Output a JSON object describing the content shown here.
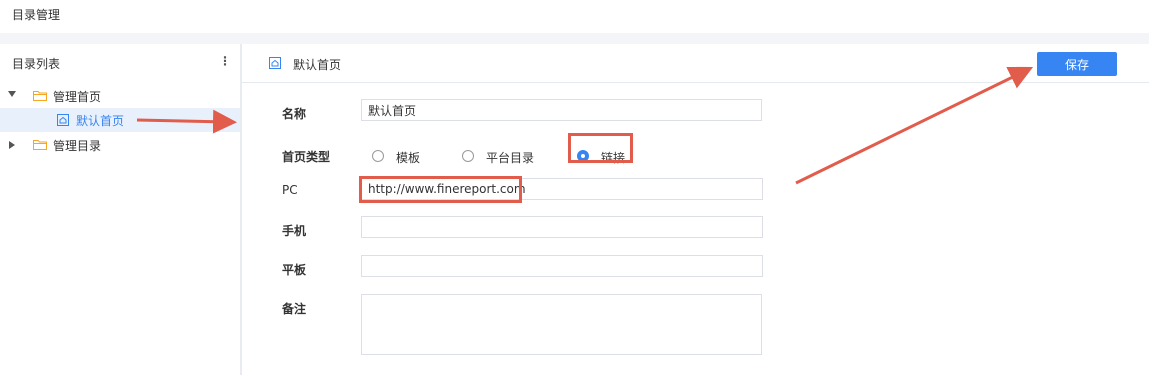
{
  "app": {
    "title": "目录管理"
  },
  "sidebar": {
    "header": "目录列表",
    "more_icon": "vertical-ellipsis-icon",
    "items": [
      {
        "label": "管理首页",
        "icon": "folder-icon",
        "expanded": true
      },
      {
        "label": "默认首页",
        "icon": "home-page-icon",
        "selected": true
      },
      {
        "label": "管理目录",
        "icon": "folder-icon",
        "expanded": false
      }
    ]
  },
  "detail": {
    "title": "默认首页",
    "save_label": "保存",
    "fields": {
      "name": {
        "label": "名称",
        "value": "默认首页"
      },
      "type": {
        "label": "首页类型",
        "options": [
          "模板",
          "平台目录",
          "链接"
        ],
        "selected": "链接"
      },
      "pc": {
        "label": "PC",
        "value": "http://www.finereport.com"
      },
      "mobile": {
        "label": "手机",
        "value": ""
      },
      "tablet": {
        "label": "平板",
        "value": ""
      },
      "remark": {
        "label": "备注",
        "value": ""
      }
    }
  },
  "colors": {
    "accent": "#3685f2",
    "highlight": "#e25c4c",
    "folder": "#f5a623",
    "selected_bg": "#e8f0fb"
  }
}
